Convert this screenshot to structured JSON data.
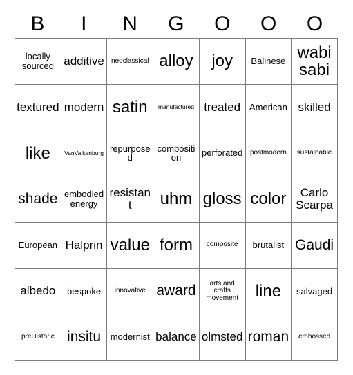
{
  "card": {
    "title": "Bingo Card",
    "header_letters": [
      "B",
      "I",
      "N",
      "G",
      "O",
      "O",
      "O"
    ],
    "columns": 7,
    "rows": 7,
    "border_color": "#7d7d7d",
    "text_color": "#000000",
    "background_color": "#ffffff",
    "cells": [
      [
        {
          "text": "locally sourced",
          "size": "sm",
          "marked": false
        },
        {
          "text": "additive",
          "size": "md",
          "marked": false
        },
        {
          "text": "neoclassical",
          "size": "xs",
          "marked": false
        },
        {
          "text": "alloy",
          "size": "xl",
          "marked": false
        },
        {
          "text": "joy",
          "size": "xl",
          "marked": false
        },
        {
          "text": "Balinese",
          "size": "sm",
          "marked": false
        },
        {
          "text": "wabi sabi",
          "size": "xl",
          "marked": false
        }
      ],
      [
        {
          "text": "textured",
          "size": "md",
          "marked": false
        },
        {
          "text": "modern",
          "size": "md",
          "marked": false
        },
        {
          "text": "satin",
          "size": "xl",
          "marked": false
        },
        {
          "text": "manufactured",
          "size": "xxs",
          "marked": false
        },
        {
          "text": "treated",
          "size": "md",
          "marked": false
        },
        {
          "text": "American",
          "size": "sm",
          "marked": false
        },
        {
          "text": "skilled",
          "size": "md",
          "marked": false
        }
      ],
      [
        {
          "text": "like",
          "size": "xl",
          "marked": false
        },
        {
          "text": "VanValkenburg",
          "size": "xxs",
          "marked": false
        },
        {
          "text": "repurposed",
          "size": "sm",
          "marked": false
        },
        {
          "text": "composition",
          "size": "sm",
          "marked": false
        },
        {
          "text": "perforated",
          "size": "sm",
          "marked": false
        },
        {
          "text": "postmodern",
          "size": "xs",
          "marked": false
        },
        {
          "text": "sustainable",
          "size": "xs",
          "marked": false
        }
      ],
      [
        {
          "text": "shade",
          "size": "lg",
          "marked": false
        },
        {
          "text": "embodied energy",
          "size": "sm",
          "marked": false
        },
        {
          "text": "resistant",
          "size": "md",
          "marked": false
        },
        {
          "text": "uhm",
          "size": "xl",
          "marked": false
        },
        {
          "text": "gloss",
          "size": "xl",
          "marked": false
        },
        {
          "text": "color",
          "size": "xl",
          "marked": false
        },
        {
          "text": "Carlo Scarpa",
          "size": "md",
          "marked": false
        }
      ],
      [
        {
          "text": "European",
          "size": "sm",
          "marked": false
        },
        {
          "text": "Halprin",
          "size": "md",
          "marked": false
        },
        {
          "text": "value",
          "size": "xl",
          "marked": false
        },
        {
          "text": "form",
          "size": "xl",
          "marked": false
        },
        {
          "text": "composite",
          "size": "xs",
          "marked": false
        },
        {
          "text": "brutalist",
          "size": "sm",
          "marked": false
        },
        {
          "text": "Gaudi",
          "size": "lg",
          "marked": false
        }
      ],
      [
        {
          "text": "albedo",
          "size": "md",
          "marked": false
        },
        {
          "text": "bespoke",
          "size": "sm",
          "marked": false
        },
        {
          "text": "innovative",
          "size": "xs",
          "marked": false
        },
        {
          "text": "award",
          "size": "lg",
          "marked": false
        },
        {
          "text": "arts and crafts movement",
          "size": "xs",
          "marked": false
        },
        {
          "text": "line",
          "size": "xl",
          "marked": false
        },
        {
          "text": "salvaged",
          "size": "sm",
          "marked": false
        }
      ],
      [
        {
          "text": "preHistoric",
          "size": "xs",
          "marked": false
        },
        {
          "text": "insitu",
          "size": "lg",
          "marked": false
        },
        {
          "text": "modernist",
          "size": "sm",
          "marked": false
        },
        {
          "text": "balance",
          "size": "md",
          "marked": false
        },
        {
          "text": "olmsted",
          "size": "md",
          "marked": false
        },
        {
          "text": "roman",
          "size": "lg",
          "marked": false
        },
        {
          "text": "embossed",
          "size": "xs",
          "marked": false
        }
      ]
    ]
  }
}
